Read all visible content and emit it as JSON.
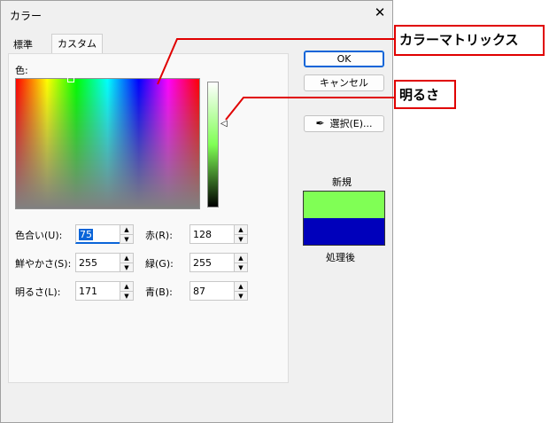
{
  "dialog": {
    "title": "カラー",
    "close_glyph": "✕",
    "tabs": [
      {
        "label": "標準"
      },
      {
        "label": "カスタム"
      }
    ],
    "color_label": "色:",
    "fields": {
      "hue": {
        "label": "色合い(U):",
        "value": "75"
      },
      "sat": {
        "label": "鮮やかさ(S):",
        "value": "255"
      },
      "lum": {
        "label": "明るさ(L):",
        "value": "171"
      },
      "red": {
        "label": "赤(R):",
        "value": "128"
      },
      "green": {
        "label": "緑(G):",
        "value": "255"
      },
      "blue": {
        "label": "青(B):",
        "value": "87"
      }
    },
    "buttons": {
      "ok": "OK",
      "cancel": "キャンセル",
      "pick": "選択(E)..."
    },
    "preview": {
      "new_label": "新規",
      "current_label": "処理後",
      "new_color": "#80ff55",
      "current_color": "#0000bb"
    }
  },
  "callouts": {
    "matrix": "カラーマトリックス",
    "lum": "明るさ",
    "color": "#e00000"
  }
}
